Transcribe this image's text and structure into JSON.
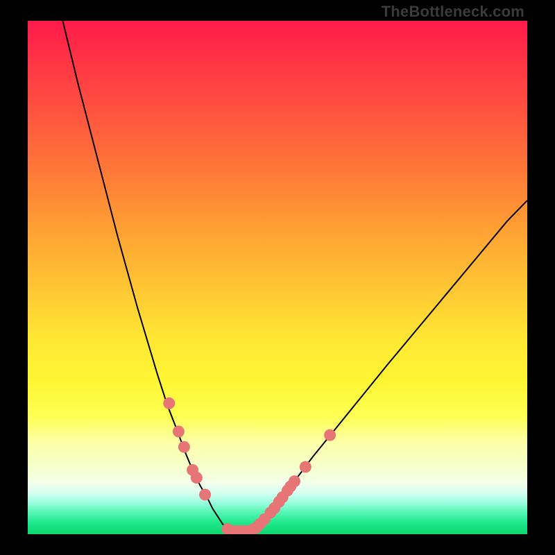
{
  "watermark": "TheBottleneck.com",
  "chart_data": {
    "type": "line",
    "title": "",
    "xlabel": "",
    "ylabel": "",
    "xlim": [
      0,
      100
    ],
    "ylim": [
      0,
      100
    ],
    "series": [
      {
        "name": "curve-left",
        "x": [
          7,
          10,
          14,
          18,
          22,
          26,
          28,
          30,
          31.5,
          33,
          34.5,
          36,
          37,
          38,
          39,
          40
        ],
        "values": [
          100,
          88,
          73,
          58,
          44,
          31,
          25,
          20,
          16,
          12.5,
          9.5,
          7,
          5,
          3.5,
          2,
          1
        ]
      },
      {
        "name": "curve-bottom",
        "x": [
          40,
          41,
          42,
          43,
          44,
          45
        ],
        "values": [
          1,
          0.6,
          0.5,
          0.5,
          0.6,
          0.8
        ]
      },
      {
        "name": "curve-right",
        "x": [
          45,
          46,
          48,
          50,
          53,
          57,
          62,
          67,
          72,
          78,
          84,
          90,
          96,
          100
        ],
        "values": [
          0.8,
          1.4,
          3.4,
          6,
          9.8,
          15,
          21,
          27,
          33,
          40,
          47,
          54,
          61,
          65
        ]
      }
    ],
    "markers": [
      {
        "x": 28.3,
        "y": 25.5
      },
      {
        "x": 30.2,
        "y": 20.0
      },
      {
        "x": 31.3,
        "y": 17.0
      },
      {
        "x": 33.0,
        "y": 12.5
      },
      {
        "x": 33.8,
        "y": 11.0
      },
      {
        "x": 35.5,
        "y": 7.7
      },
      {
        "x": 40.0,
        "y": 1.0
      },
      {
        "x": 41.0,
        "y": 0.6
      },
      {
        "x": 42.0,
        "y": 0.6
      },
      {
        "x": 43.0,
        "y": 0.6
      },
      {
        "x": 43.8,
        "y": 0.6
      },
      {
        "x": 45.0,
        "y": 0.9
      },
      {
        "x": 45.8,
        "y": 1.3
      },
      {
        "x": 46.5,
        "y": 2.0
      },
      {
        "x": 47.4,
        "y": 2.9
      },
      {
        "x": 48.6,
        "y": 4.2
      },
      {
        "x": 49.4,
        "y": 5.1
      },
      {
        "x": 50.3,
        "y": 6.3
      },
      {
        "x": 51.0,
        "y": 7.2
      },
      {
        "x": 52.0,
        "y": 8.5
      },
      {
        "x": 52.6,
        "y": 9.3
      },
      {
        "x": 53.4,
        "y": 10.3
      },
      {
        "x": 55.6,
        "y": 13.1
      },
      {
        "x": 60.5,
        "y": 19.3
      }
    ],
    "marker_color": "#e77575",
    "curve_color": "#000000"
  }
}
